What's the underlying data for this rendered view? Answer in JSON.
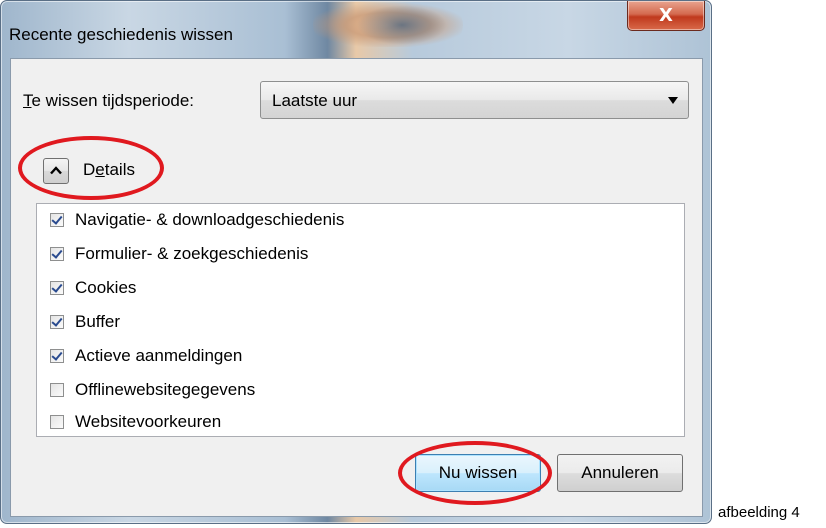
{
  "window": {
    "title": "Recente geschiedenis wissen",
    "close_glyph": "X"
  },
  "period": {
    "label_prefix": "T",
    "label_rest": "e wissen tijdsperiode:",
    "selected": "Laatste uur"
  },
  "details": {
    "label_prefix": "D",
    "label_underlined": "e",
    "label_rest": "tails",
    "expanded": true
  },
  "items": [
    {
      "label": "Navigatie- & downloadgeschiedenis",
      "checked": true
    },
    {
      "label": "Formulier- & zoekgeschiedenis",
      "checked": true
    },
    {
      "label": "Cookies",
      "checked": true
    },
    {
      "label": "Buffer",
      "checked": true
    },
    {
      "label": "Actieve aanmeldingen",
      "checked": true
    },
    {
      "label": "Offlinewebsitegegevens",
      "checked": false
    },
    {
      "label": "Websitevoorkeuren",
      "checked": false
    }
  ],
  "buttons": {
    "clear": "Nu wissen",
    "cancel": "Annuleren"
  },
  "caption": "afbeelding 4",
  "colors": {
    "annotation": "#e0191f",
    "checkmark": "#2a4b8f"
  }
}
